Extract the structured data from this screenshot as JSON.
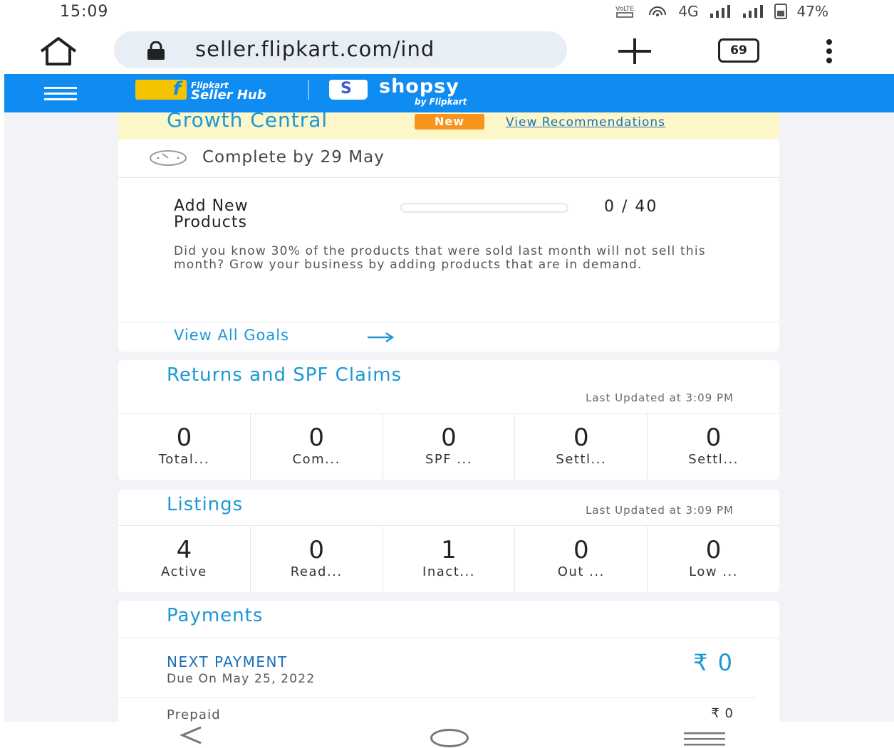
{
  "status_bar": {
    "time": "15:09",
    "network": "4G",
    "battery": "47%"
  },
  "browser": {
    "url": "seller.flipkart.com/ind",
    "tab_count": "69"
  },
  "header": {
    "brand_small": "Flipkart",
    "brand_name": "Seller Hub",
    "brand_logo_letter": "f",
    "partner_letter": "S",
    "partner_name": "shopsy",
    "partner_sub": "by Flipkart"
  },
  "growth_central": {
    "title": "Growth Central",
    "badge": "New",
    "link": "View Recommendations",
    "deadline": "Complete by 29 May",
    "goal_name": "Add New Products",
    "goal_count": "0 / 40",
    "goal_progress": 0,
    "goal_description": "Did you know 30% of the products that were sold last month will not sell this month? Grow your business by adding products that are in demand.",
    "view_all": "View All Goals"
  },
  "returns": {
    "title": "Returns and SPF Claims",
    "updated": "Last Updated at 3:09 PM",
    "stats": [
      {
        "value": "0",
        "label": "Total..."
      },
      {
        "value": "0",
        "label": "Com..."
      },
      {
        "value": "0",
        "label": "SPF ..."
      },
      {
        "value": "0",
        "label": "Settl..."
      },
      {
        "value": "0",
        "label": "Settl..."
      }
    ]
  },
  "listings": {
    "title": "Listings",
    "updated": "Last Updated at 3:09 PM",
    "stats": [
      {
        "value": "4",
        "label": "Active"
      },
      {
        "value": "0",
        "label": "Read..."
      },
      {
        "value": "1",
        "label": "Inact..."
      },
      {
        "value": "0",
        "label": "Out ..."
      },
      {
        "value": "0",
        "label": "Low ..."
      }
    ]
  },
  "payments": {
    "title": "Payments",
    "next_label": "NEXT PAYMENT",
    "due": "Due On May 25, 2022",
    "amount": "₹ 0",
    "prepaid_label": "Prepaid",
    "prepaid_amount": "₹ 0"
  },
  "colors": {
    "header_blue": "#0f8cf2",
    "title_blue": "#1a98d5",
    "badge_orange": "#f7941d",
    "banner_yellow": "#fdf6c8"
  }
}
